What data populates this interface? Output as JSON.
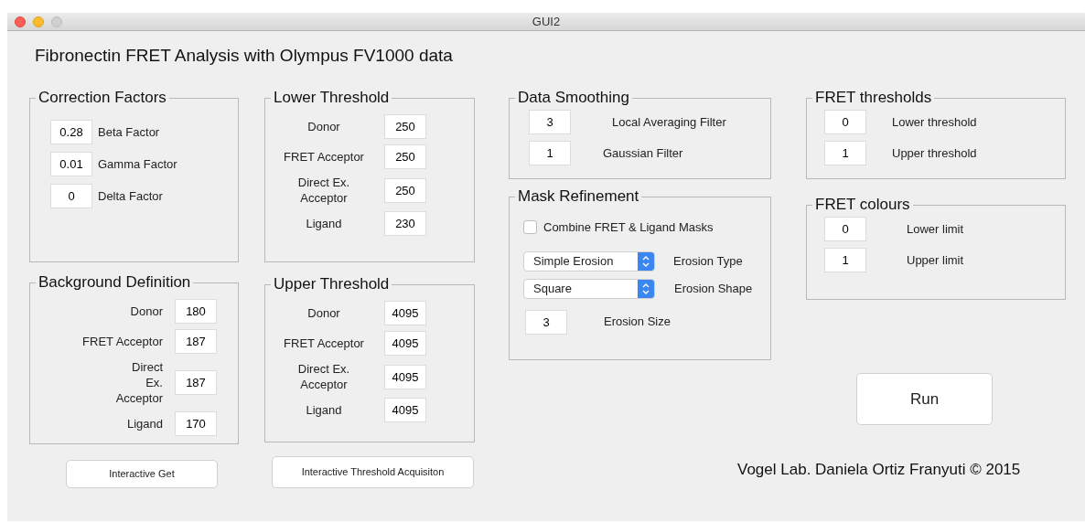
{
  "window": {
    "title": "GUI2"
  },
  "heading": "Fibronectin FRET Analysis with Olympus FV1000 data",
  "correction_factors": {
    "title": "Correction Factors",
    "rows": [
      {
        "value": "0.28",
        "label": "Beta Factor"
      },
      {
        "value": "0.01",
        "label": "Gamma Factor"
      },
      {
        "value": "0",
        "label": "Delta Factor"
      }
    ]
  },
  "background_definition": {
    "title": "Background Definition",
    "rows": [
      {
        "label": "Donor",
        "value": "180"
      },
      {
        "label": "FRET Acceptor",
        "value": "187"
      },
      {
        "label": "Direct Ex. Acceptor",
        "value": "187"
      },
      {
        "label": "Ligand",
        "value": "170"
      }
    ]
  },
  "interactive_get_button": "Interactive Get",
  "lower_threshold": {
    "title": "Lower Threshold",
    "rows": [
      {
        "label": "Donor",
        "value": "250"
      },
      {
        "label": "FRET Acceptor",
        "value": "250"
      },
      {
        "label": "Direct Ex. Acceptor",
        "value": "250"
      },
      {
        "label": "Ligand",
        "value": "230"
      }
    ]
  },
  "upper_threshold": {
    "title": "Upper Threshold",
    "rows": [
      {
        "label": "Donor",
        "value": "4095"
      },
      {
        "label": "FRET Acceptor",
        "value": "4095"
      },
      {
        "label": "Direct Ex. Acceptor",
        "value": "4095"
      },
      {
        "label": "Ligand",
        "value": "4095"
      }
    ]
  },
  "interactive_threshold_button": "Interactive Threshold Acquisiton",
  "data_smoothing": {
    "title": "Data Smoothing",
    "rows": [
      {
        "value": "3",
        "label": "Local Averaging Filter"
      },
      {
        "value": "1",
        "label": "Gaussian Filter"
      }
    ]
  },
  "mask_refinement": {
    "title": "Mask Refinement",
    "checkbox": {
      "label": "Combine FRET & Ligand Masks",
      "checked": false
    },
    "dropdowns": [
      {
        "value": "Simple Erosion",
        "label": "Erosion Type"
      },
      {
        "value": "Square",
        "label": "Erosion Shape"
      }
    ],
    "size": {
      "value": "3",
      "label": "Erosion Size"
    }
  },
  "fret_thresholds": {
    "title": "FRET thresholds",
    "rows": [
      {
        "value": "0",
        "label": "Lower threshold"
      },
      {
        "value": "1",
        "label": "Upper threshold"
      }
    ]
  },
  "fret_colours": {
    "title": "FRET colours",
    "rows": [
      {
        "value": "0",
        "label": "Lower limit"
      },
      {
        "value": "1",
        "label": "Upper limit"
      }
    ]
  },
  "run_button": "Run",
  "credit": "Vogel Lab. Daniela Ortiz Franyuti © 2015"
}
